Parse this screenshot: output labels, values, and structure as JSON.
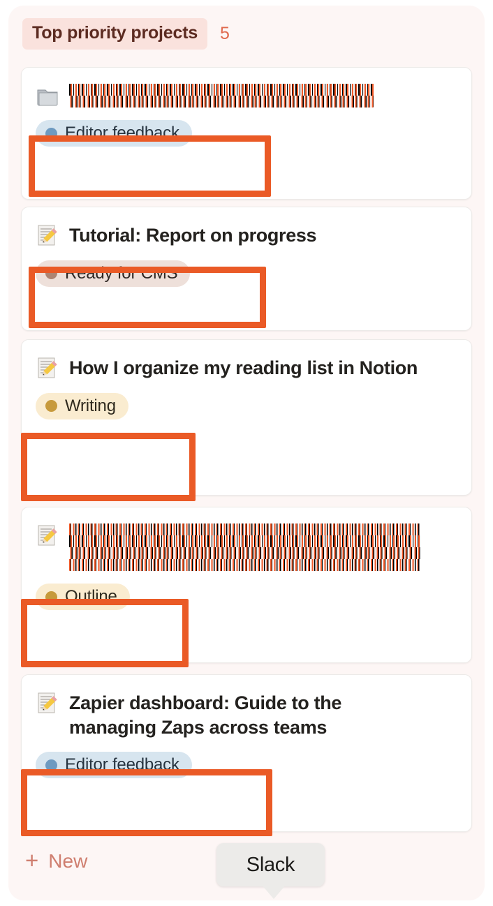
{
  "column": {
    "title": "Top priority projects",
    "count": "5",
    "title_badge_bg": "#fae2dd",
    "title_text_color": "#5c2b21",
    "count_color": "#e06a4e",
    "background": "#fdf6f5"
  },
  "annotation": {
    "color": "#ea5a26",
    "shape": "rectangle-outline"
  },
  "cards": [
    {
      "icon": "folder-icon",
      "title": "",
      "title_redacted": true,
      "title_lines": 1,
      "tag": {
        "label": "Editor feedback",
        "dot_color": "#6e9ac0",
        "bg_color": "#d7e5ef",
        "text_color": "#26333f"
      }
    },
    {
      "icon": "memo-icon",
      "title": "Tutorial: Report on progress",
      "title_redacted": false,
      "title_lines": 1,
      "tag": {
        "label": "Ready for CMS",
        "dot_color": "#ad8472",
        "bg_color": "#eee0da",
        "text_color": "#2f2723"
      }
    },
    {
      "icon": "memo-icon",
      "title": "How I organize my reading list in Notion",
      "title_redacted": false,
      "title_lines": 2,
      "tag": {
        "label": "Writing",
        "dot_color": "#c79a3c",
        "bg_color": "#faecd0",
        "text_color": "#2f2a1e"
      }
    },
    {
      "icon": "memo-icon",
      "title": "",
      "title_redacted": true,
      "title_lines": 2,
      "tag": {
        "label": "Outline",
        "dot_color": "#c79a3c",
        "bg_color": "#faecd0",
        "text_color": "#2f2a1e"
      }
    },
    {
      "icon": "memo-icon",
      "title": "Zapier dashboard: Guide to the managing Zaps across teams",
      "title_redacted": false,
      "title_lines": 2,
      "tag": {
        "label": "Editor feedback",
        "dot_color": "#6e9ac0",
        "bg_color": "#d7e5ef",
        "text_color": "#26333f"
      }
    }
  ],
  "footer": {
    "new_label": "New",
    "new_plus": "+",
    "new_color": "#cf7e6f"
  },
  "tooltip": {
    "label": "Slack",
    "bg_color": "#ecebe9",
    "text_color": "#1c1b19"
  }
}
